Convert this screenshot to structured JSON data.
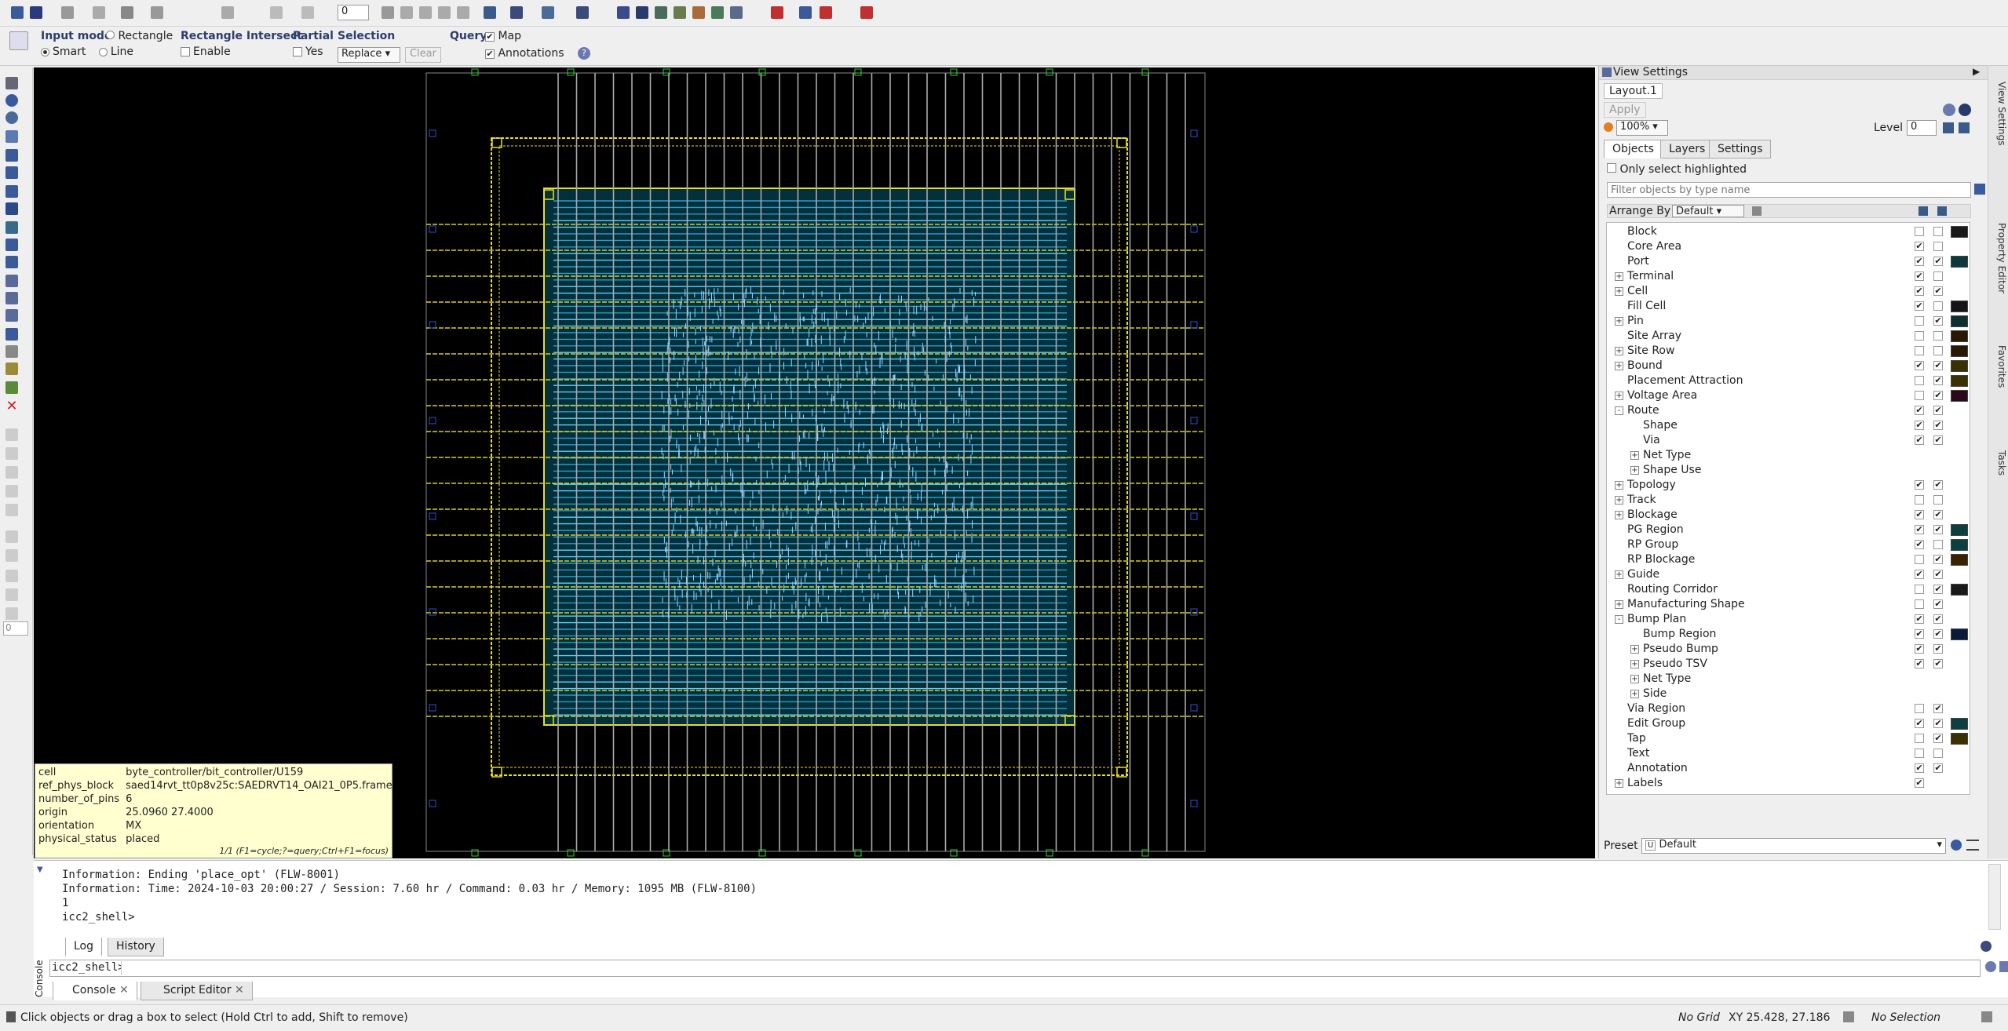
{
  "toolbar": {
    "level_value": "0"
  },
  "select_bar": {
    "input_mode": {
      "title": "Input mode",
      "smart": "Smart",
      "rectangle": "Rectangle",
      "line": "Line"
    },
    "rect_intersect": {
      "title": "Rectangle Intersect",
      "enable": "Enable"
    },
    "partial": {
      "title": "Partial",
      "yes": "Yes"
    },
    "selection": {
      "title": "Selection",
      "value": "Replace",
      "clear": "Clear"
    },
    "query": {
      "title": "Query",
      "map": "Map",
      "annotations": "Annotations"
    }
  },
  "left_toolbar": {
    "field_value": "0"
  },
  "info_box": {
    "rows": [
      {
        "k": "cell",
        "v": "byte_controller/bit_controller/U159"
      },
      {
        "k": "ref_phys_block",
        "v": "saed14rvt_tt0p8v25c:SAEDRVT14_OAI21_0P5.frame"
      },
      {
        "k": "number_of_pins",
        "v": "6"
      },
      {
        "k": "origin",
        "v": "25.0960 27.4000"
      },
      {
        "k": "orientation",
        "v": "MX"
      },
      {
        "k": "physical_status",
        "v": "placed"
      }
    ],
    "footer": "1/1 (F1=cycle;?=query;Ctrl+F1=focus)"
  },
  "view_settings": {
    "title": "View Settings",
    "layout_tab": "Layout.1",
    "apply": "Apply",
    "zoom": "100%",
    "level_label": "Level",
    "level_value": "0",
    "tabs": [
      "Objects",
      "Layers",
      "Settings"
    ],
    "only_highlighted": "Only select highlighted",
    "filter_placeholder": "Filter objects by type name",
    "arrange_label": "Arrange By",
    "arrange_value": "Default",
    "preset_label": "Preset",
    "preset_value": "Default",
    "items": [
      {
        "label": "Block",
        "indent": 0,
        "exp": "",
        "vis": false,
        "sel": false,
        "sw": "#1a1a1a"
      },
      {
        "label": "Core Area",
        "indent": 0,
        "exp": "",
        "vis": true,
        "sel": false,
        "sw": ""
      },
      {
        "label": "Port",
        "indent": 0,
        "exp": "",
        "vis": true,
        "sel": true,
        "sw": "#0c3a3a"
      },
      {
        "label": "Terminal",
        "indent": 0,
        "exp": "+",
        "vis": true,
        "sel": false,
        "sw": ""
      },
      {
        "label": "Cell",
        "indent": 0,
        "exp": "+",
        "vis": true,
        "sel": true,
        "sw": ""
      },
      {
        "label": "Fill Cell",
        "indent": 0,
        "exp": "",
        "vis": true,
        "sel": false,
        "sw": "#151515"
      },
      {
        "label": "Pin",
        "indent": 0,
        "exp": "+",
        "vis": false,
        "sel": true,
        "sw": "#0a3030"
      },
      {
        "label": "Site Array",
        "indent": 0,
        "exp": "",
        "vis": false,
        "sel": false,
        "sw": "#2a1800"
      },
      {
        "label": "Site Row",
        "indent": 0,
        "exp": "+",
        "vis": false,
        "sel": false,
        "sw": "#2a1800"
      },
      {
        "label": "Bound",
        "indent": 0,
        "exp": "+",
        "vis": true,
        "sel": true,
        "sw": "#3a3000"
      },
      {
        "label": "Placement Attraction",
        "indent": 0,
        "exp": "",
        "vis": false,
        "sel": true,
        "sw": "#3a3000"
      },
      {
        "label": "Voltage Area",
        "indent": 0,
        "exp": "+",
        "vis": false,
        "sel": true,
        "sw": "#2a0a1a"
      },
      {
        "label": "Route",
        "indent": 0,
        "exp": "-",
        "vis": true,
        "sel": true,
        "sw": ""
      },
      {
        "label": "Shape",
        "indent": 1,
        "exp": "",
        "vis": true,
        "sel": true,
        "sw": ""
      },
      {
        "label": "Via",
        "indent": 1,
        "exp": "",
        "vis": true,
        "sel": true,
        "sw": ""
      },
      {
        "label": "Net Type",
        "indent": 1,
        "exp": "+",
        "vis": null,
        "sel": null,
        "sw": ""
      },
      {
        "label": "Shape Use",
        "indent": 1,
        "exp": "+",
        "vis": null,
        "sel": null,
        "sw": ""
      },
      {
        "label": "Topology",
        "indent": 0,
        "exp": "+",
        "vis": true,
        "sel": true,
        "sw": ""
      },
      {
        "label": "Track",
        "indent": 0,
        "exp": "+",
        "vis": false,
        "sel": false,
        "sw": ""
      },
      {
        "label": "Blockage",
        "indent": 0,
        "exp": "+",
        "vis": true,
        "sel": true,
        "sw": ""
      },
      {
        "label": "PG Region",
        "indent": 0,
        "exp": "",
        "vis": true,
        "sel": true,
        "sw": "#0a4040"
      },
      {
        "label": "RP Group",
        "indent": 0,
        "exp": "",
        "vis": true,
        "sel": false,
        "sw": "#0a4040"
      },
      {
        "label": "RP Blockage",
        "indent": 0,
        "exp": "",
        "vis": false,
        "sel": true,
        "sw": "#3a2400"
      },
      {
        "label": "Guide",
        "indent": 0,
        "exp": "+",
        "vis": true,
        "sel": true,
        "sw": ""
      },
      {
        "label": "Routing Corridor",
        "indent": 0,
        "exp": "",
        "vis": false,
        "sel": true,
        "sw": "#1a1a1a"
      },
      {
        "label": "Manufacturing Shape",
        "indent": 0,
        "exp": "+",
        "vis": false,
        "sel": true,
        "sw": ""
      },
      {
        "label": "Bump Plan",
        "indent": 0,
        "exp": "-",
        "vis": true,
        "sel": true,
        "sw": ""
      },
      {
        "label": "Bump Region",
        "indent": 1,
        "exp": "",
        "vis": true,
        "sel": true,
        "sw": "#0a1a3a"
      },
      {
        "label": "Pseudo Bump",
        "indent": 1,
        "exp": "+",
        "vis": true,
        "sel": true,
        "sw": ""
      },
      {
        "label": "Pseudo TSV",
        "indent": 1,
        "exp": "+",
        "vis": true,
        "sel": true,
        "sw": ""
      },
      {
        "label": "Net Type",
        "indent": 1,
        "exp": "+",
        "vis": null,
        "sel": null,
        "sw": ""
      },
      {
        "label": "Side",
        "indent": 1,
        "exp": "+",
        "vis": null,
        "sel": null,
        "sw": ""
      },
      {
        "label": "Via Region",
        "indent": 0,
        "exp": "",
        "vis": false,
        "sel": true,
        "sw": ""
      },
      {
        "label": "Edit Group",
        "indent": 0,
        "exp": "",
        "vis": true,
        "sel": true,
        "sw": "#0a4040"
      },
      {
        "label": "Tap",
        "indent": 0,
        "exp": "",
        "vis": false,
        "sel": true,
        "sw": "#3a3000"
      },
      {
        "label": "Text",
        "indent": 0,
        "exp": "",
        "vis": false,
        "sel": false,
        "sw": ""
      },
      {
        "label": "Annotation",
        "indent": 0,
        "exp": "",
        "vis": true,
        "sel": true,
        "sw": ""
      },
      {
        "label": "Labels",
        "indent": 0,
        "exp": "+",
        "vis": true,
        "sel": null,
        "sw": ""
      }
    ]
  },
  "side_tabs": [
    "View Settings",
    "Property Editor",
    "Favorites",
    "Tasks"
  ],
  "console": {
    "lines": [
      "Information: Ending 'place_opt' (FLW-8001)",
      "Information: Time: 2024-10-03 20:00:27 / Session: 7.60 hr / Command: 0.03 hr / Memory: 1095 MB (FLW-8100)",
      "1",
      "icc2_shell>"
    ],
    "tabs": [
      "Log",
      "History"
    ],
    "prompt": "icc2_shell>",
    "side_label": "Console",
    "bottom_tabs": [
      "Console",
      "Script Editor"
    ]
  },
  "status": {
    "hint": "Click objects or drag a box to select (Hold Ctrl to add, Shift to remove)",
    "grid": "No Grid",
    "coords": "XY 25.428, 27.186",
    "selection": "No Selection"
  }
}
